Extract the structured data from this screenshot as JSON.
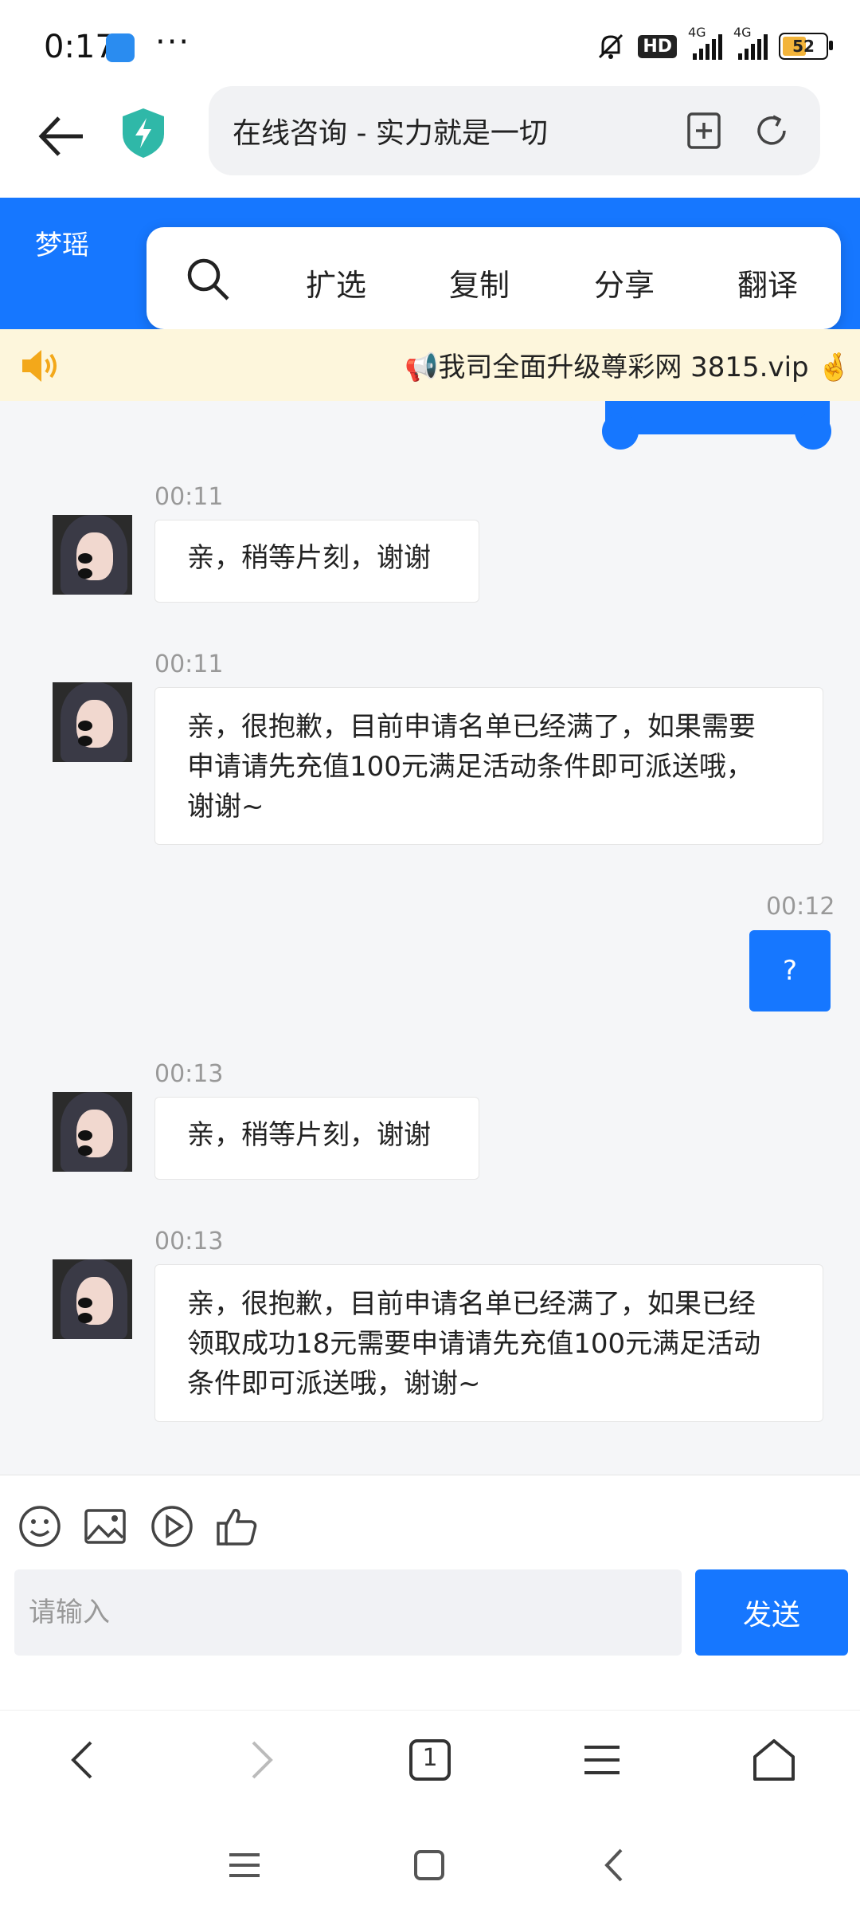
{
  "status_bar": {
    "time": "0:17",
    "more": "···",
    "hd_label": "HD",
    "net1": "4G",
    "net2": "4G",
    "battery": "52"
  },
  "browser": {
    "page_title": "在线咨询 - 实力就是一切"
  },
  "chat_header": {
    "agent_name": "梦瑶"
  },
  "selection_menu": {
    "items": [
      "扩选",
      "复制",
      "分享",
      "翻译"
    ]
  },
  "notice": {
    "text": "📢我司全面升级尊彩网 3815.vip 🤞"
  },
  "messages": [
    {
      "from": "agent",
      "time": "00:11",
      "text": "亲，稍等片刻，谢谢"
    },
    {
      "from": "agent",
      "time": "00:11",
      "lines": [
        "亲，很抱歉，目前申请名单已经满了，如果需要",
        "申请请先充值100元满足活动条件即可派送哦，",
        "谢谢~"
      ]
    },
    {
      "from": "user",
      "time": "00:12",
      "text": "?"
    },
    {
      "from": "agent",
      "time": "00:13",
      "text": "亲，稍等片刻，谢谢"
    },
    {
      "from": "agent",
      "time": "00:13",
      "lines": [
        "亲，很抱歉，目前申请名单已经满了，如果已经",
        "领取成功18元需要申请请先充值100元满足活动",
        "条件即可派送哦，谢谢~"
      ]
    }
  ],
  "composer": {
    "placeholder": "请输入",
    "send_label": "发送"
  },
  "browser_nav": {
    "tab_count": "1"
  }
}
